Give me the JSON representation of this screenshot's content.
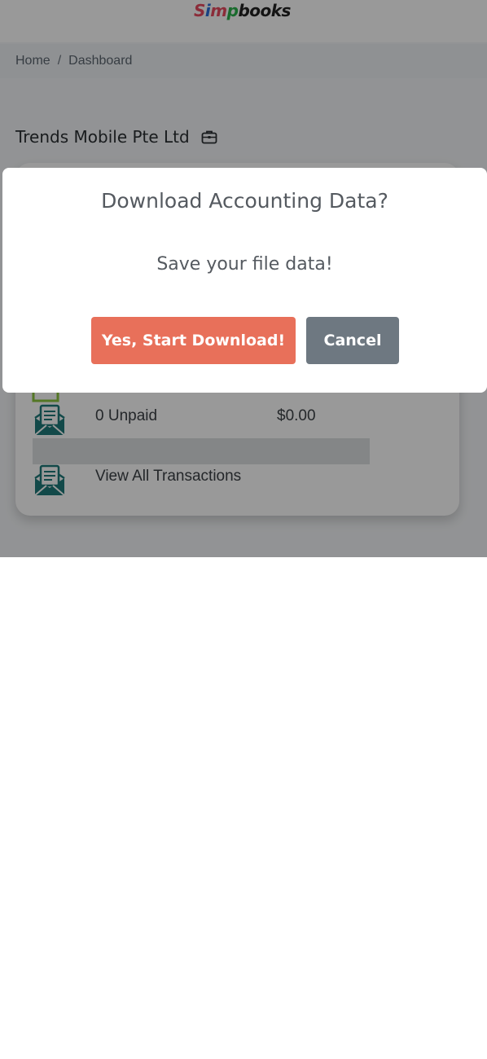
{
  "app": {
    "logo_text": "Simpbooks",
    "logo_colors": [
      "#e84a5f",
      "#2a6fdb",
      "#2bb24c",
      "#222222"
    ]
  },
  "breadcrumb": {
    "home": "Home",
    "separator": "/",
    "current": "Dashboard"
  },
  "company": {
    "name": "Trends Mobile Pte Ltd",
    "icon": "briefcase-icon"
  },
  "card": {
    "rows": [
      {
        "label": "0 Unpaid",
        "amount": "$0.00",
        "icon": "envelope-document-icon"
      },
      {
        "label": "View All Transactions",
        "amount": "",
        "icon": "envelope-document-icon"
      }
    ]
  },
  "modal": {
    "title": "Download Accounting Data?",
    "text": "Save your file data!",
    "confirm_label": "Yes, Start Download!",
    "cancel_label": "Cancel"
  },
  "colors": {
    "confirm": "#e8705a",
    "cancel": "#6e7881",
    "icon_teal": "#1f7a7a",
    "icon_green": "#8dc63f"
  }
}
